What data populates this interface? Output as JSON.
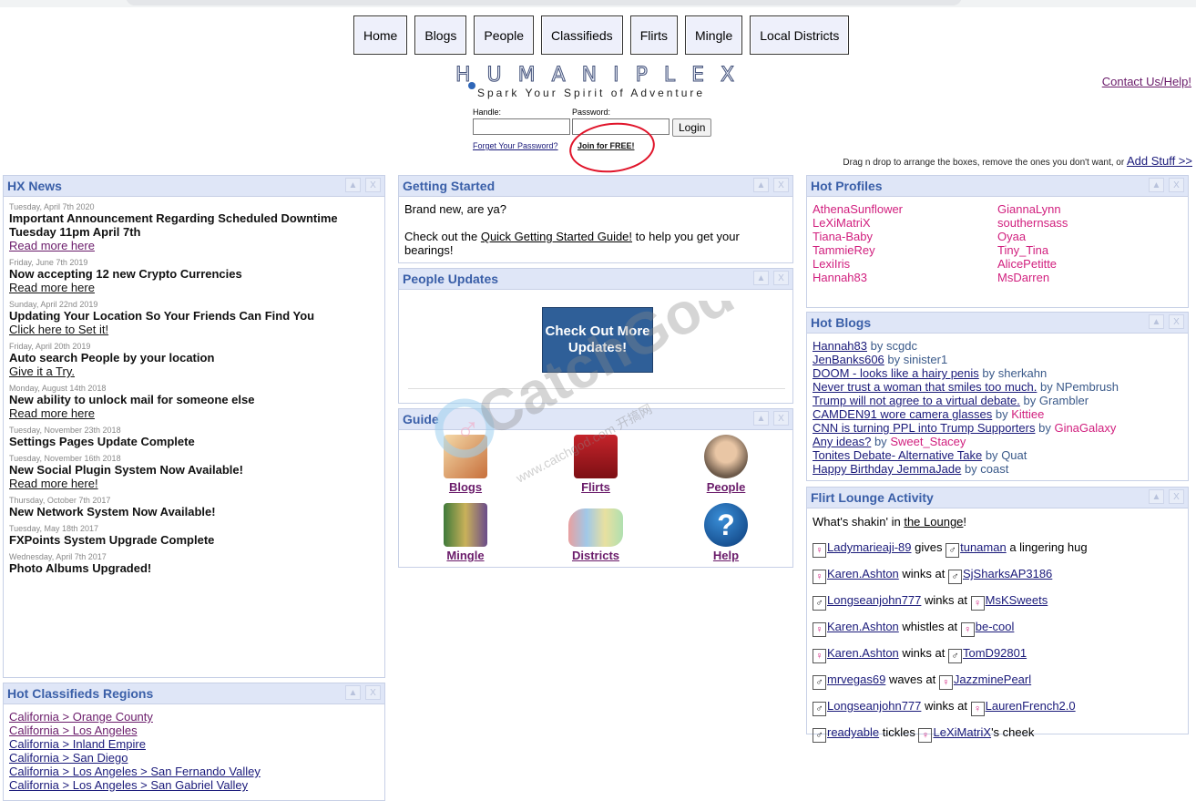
{
  "nav": [
    "Home",
    "Blogs",
    "People",
    "Classifieds",
    "Flirts",
    "Mingle",
    "Local Districts"
  ],
  "logo": {
    "letters": "HUMANIPLEX",
    "tagline": "Spark Your Spirit of Adventure"
  },
  "login": {
    "handle_label": "Handle:",
    "password_label": "Password:",
    "login_button": "Login",
    "forgot": "Forget Your Password?",
    "join": "Join for FREE!"
  },
  "contact": "Contact Us/Help!",
  "dragnote": {
    "text": "Drag n drop to arrange the boxes, remove the ones you don't want, or ",
    "link": "Add Stuff >>"
  },
  "box_controls": {
    "up": "▲",
    "close": "X"
  },
  "hx_news": {
    "title": "HX News",
    "items": [
      {
        "date": "Tuesday, April 7th 2020",
        "title": "Important Announcement Regarding Scheduled Downtime Tuesday 11pm April 7th",
        "link": "Read more here"
      },
      {
        "date": "Friday, June 7th 2019",
        "title": "Now accepting 12 new Crypto Currencies",
        "link": "Read more here"
      },
      {
        "date": "Sunday, April 22nd 2019",
        "title": "Updating Your Location So Your Friends Can Find You",
        "link": "Click here to Set it!"
      },
      {
        "date": "Friday, April 20th 2019",
        "title": "Auto search People by your location",
        "link": "Give it a Try."
      },
      {
        "date": "Monday, August 14th 2018",
        "title": "New ability to unlock mail for someone else",
        "link": "Read more here"
      },
      {
        "date": "Tuesday, November 23th 2018",
        "title": "Settings Pages Update Complete",
        "link": ""
      },
      {
        "date": "Tuesday, November 16th 2018",
        "title": "New Social Plugin System Now Available!",
        "link": "Read more here!"
      },
      {
        "date": "Thursday, October 7th 2017",
        "title": "New Network System Now Available!",
        "link": ""
      },
      {
        "date": "Tuesday, May 18th 2017",
        "title": "FXPoints System Upgrade Complete",
        "link": ""
      },
      {
        "date": "Wednesday, April 7th 2017",
        "title": "Photo Albums Upgraded!",
        "link": ""
      }
    ]
  },
  "classifieds": {
    "title": "Hot Classifieds Regions",
    "items": [
      "California > Orange County",
      "California > Los Angeles",
      "California > Inland Empire",
      "California > San Diego",
      "California > Los Angeles > San Fernando Valley",
      "California > Los Angeles > San Gabriel Valley"
    ]
  },
  "getting_started": {
    "title": "Getting Started",
    "line1": "Brand new, are ya?",
    "line2_pre": "Check out the ",
    "line2_link": "Quick Getting Started Guide!",
    "line2_post": " to help you get your bearings!"
  },
  "people_updates": {
    "title": "People Updates",
    "button": "Check Out More Updates!"
  },
  "guide": {
    "title": "Guide",
    "items": [
      "Blogs",
      "Flirts",
      "People",
      "Mingle",
      "Districts",
      "Help"
    ]
  },
  "hot_profiles": {
    "title": "Hot Profiles",
    "col1": [
      "AthenaSunflower",
      "LeXiMatriX",
      "Tiana-Baby",
      "TammieRey",
      "LexiIris",
      "Hannah83"
    ],
    "col2": [
      "GiannaLynn",
      "southernsass",
      "Oyaa",
      "Tiny_Tina",
      "AlicePetitte",
      "MsDarren"
    ]
  },
  "hot_blogs": {
    "title": "Hot Blogs",
    "by": "by",
    "items": [
      {
        "t": "Hannah83",
        "a": "scgdc",
        "pink": false
      },
      {
        "t": "JenBanks606",
        "a": "sinister1",
        "pink": false
      },
      {
        "t": "DOOM - looks like a hairy penis",
        "a": "sherkahn",
        "pink": false
      },
      {
        "t": "Never trust a woman that smiles too much.",
        "a": "NPembrush",
        "pink": false
      },
      {
        "t": "Trump will not agree to a virtual debate.",
        "a": "Grambler",
        "pink": false
      },
      {
        "t": "CAMDEN91 wore camera glasses",
        "a": "Kittiee",
        "pink": true
      },
      {
        "t": "CNN is turning PPL into Trump Supporters",
        "a": "GinaGalaxy",
        "pink": true
      },
      {
        "t": "Any ideas?",
        "a": "Sweet_Stacey",
        "pink": true
      },
      {
        "t": "Tonites Debate- Alternative Take",
        "a": "Quat",
        "pink": false
      },
      {
        "t": "Happy Birthday JemmaJade",
        "a": "coast",
        "pink": false
      }
    ]
  },
  "flirt": {
    "title": "Flirt Lounge Activity",
    "intro_pre": "What's shakin' in ",
    "intro_link": "the Lounge",
    "intro_post": "!",
    "rows": [
      {
        "g1": "f",
        "u1": "Ladymarieaji-89",
        "act": "gives",
        "g2": "m",
        "u2": "tunaman",
        "post": "a lingering hug"
      },
      {
        "g1": "f",
        "u1": "Karen.Ashton",
        "act": "winks at",
        "g2": "m",
        "u2": "SjSharksAP3186",
        "post": ""
      },
      {
        "g1": "m",
        "u1": "Longseanjohn777",
        "act": "winks at",
        "g2": "f",
        "u2": "MsKSweets",
        "post": ""
      },
      {
        "g1": "f",
        "u1": "Karen.Ashton",
        "act": "whistles at",
        "g2": "f",
        "u2": "be-cool",
        "post": ""
      },
      {
        "g1": "f",
        "u1": "Karen.Ashton",
        "act": "winks at",
        "g2": "m",
        "u2": "TomD92801",
        "post": ""
      },
      {
        "g1": "m",
        "u1": "mrvegas69",
        "act": "waves at",
        "g2": "f",
        "u2": "JazzminePearl",
        "post": ""
      },
      {
        "g1": "m",
        "u1": "Longseanjohn777",
        "act": "winks at",
        "g2": "f",
        "u2": "LaurenFrench2.0",
        "post": ""
      },
      {
        "g1": "m",
        "u1": "readyable",
        "act": "tickles",
        "g2": "f",
        "u2": "LeXiMatriX",
        "post": "'s cheek"
      }
    ]
  },
  "gender_symbols": {
    "f": "♀",
    "m": "♂"
  },
  "watermark": {
    "brand": "CatchGod",
    "site": "www.catchgod.com 开搞网"
  }
}
